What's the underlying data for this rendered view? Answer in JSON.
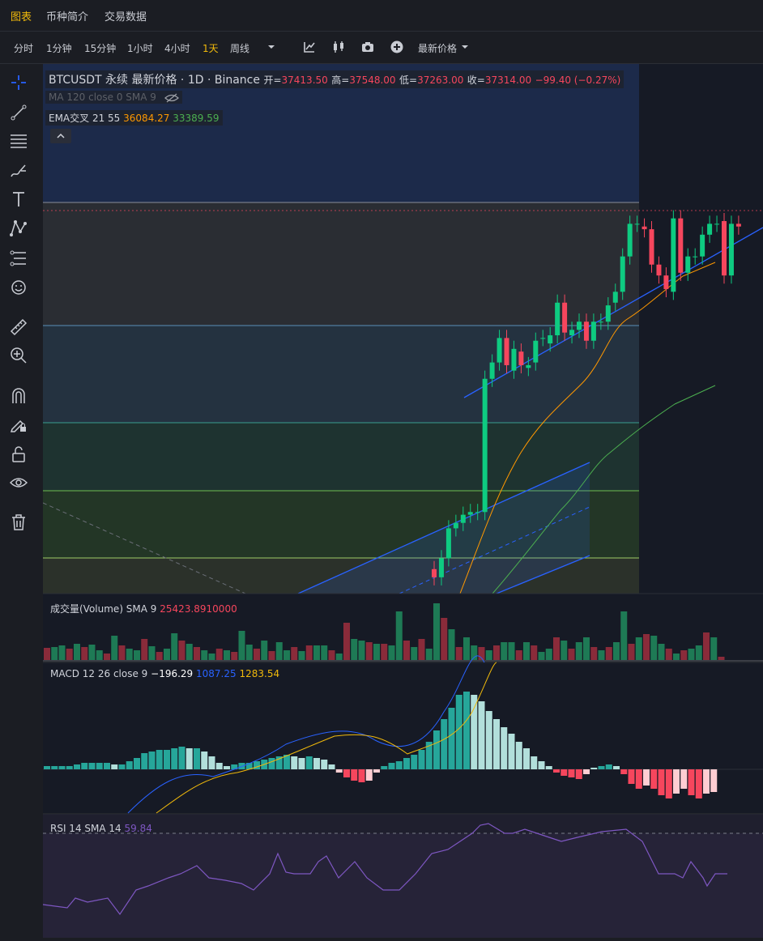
{
  "tabs": [
    "图表",
    "币种简介",
    "交易数据"
  ],
  "timeframes": [
    "分时",
    "1分钟",
    "15分钟",
    "1小时",
    "4小时",
    "1天",
    "周线"
  ],
  "active_timeframe": "1天",
  "price_type_label": "最新价格",
  "toolbar_icons": [
    "indicator-icon",
    "candle-type-icon",
    "camera-icon",
    "add-icon"
  ],
  "sidebar_icons": [
    "crosshair-icon",
    "trendline-icon",
    "horizontal-lines-icon",
    "brush-icon",
    "text-icon",
    "pattern-icon",
    "fib-icon",
    "emoji-icon",
    "ruler-icon",
    "zoom-in-icon",
    "magnet-icon",
    "lock-drawing-icon",
    "unlock-icon",
    "eye-icon",
    "trash-icon"
  ],
  "legend": {
    "symbol": "BTCUSDT 永续 最新价格 · 1D · Binance",
    "open_label": "开=",
    "open": "37413.50",
    "high_label": "高=",
    "high": "37548.00",
    "low_label": "低=",
    "low": "37263.00",
    "close_label": "收=",
    "close": "37314.00",
    "change": "−99.40 (−0.27%)",
    "ma_line": "MA 120 close 0 SMA 9",
    "ema_label": "EMA交叉 21 55",
    "ema21": "36084.27",
    "ema55": "33389.59"
  },
  "volume_legend": {
    "label": "成交量(Volume) SMA 9",
    "value": "25423.8910000"
  },
  "macd_legend": {
    "label": "MACD 12 26 close 9",
    "hist": "−196.29",
    "macd": "1087.25",
    "signal": "1283.54"
  },
  "rsi_legend": {
    "label": "RSI 14 SMA 14",
    "value": "59.84"
  },
  "colors": {
    "up": "#26a69a",
    "up_bright": "#0ecb81",
    "down": "#f6465d",
    "accent": "#f0b90b",
    "ema21": "#ff9800",
    "ema55": "#4caf50",
    "rsi": "#7e57c2",
    "macd": "#2962ff",
    "signal": "#f0b90b"
  },
  "chart_data": {
    "type": "candlestick",
    "symbol": "BTCUSDT",
    "interval": "1D",
    "last_close": 37314.0,
    "candles_recent": [
      {
        "o": 26900,
        "c": 26600
      },
      {
        "o": 26600,
        "c": 27300
      },
      {
        "o": 27300,
        "c": 28400
      },
      {
        "o": 28400,
        "c": 28600
      },
      {
        "o": 28600,
        "c": 28900
      },
      {
        "o": 28900,
        "c": 29000
      },
      {
        "o": 29000,
        "c": 29000
      },
      {
        "o": 29000,
        "c": 33900
      },
      {
        "o": 33900,
        "c": 34500
      },
      {
        "o": 34500,
        "c": 35400
      },
      {
        "o": 35400,
        "c": 34400
      },
      {
        "o": 34200,
        "c": 35000
      },
      {
        "o": 34900,
        "c": 34400
      },
      {
        "o": 34300,
        "c": 34400
      },
      {
        "o": 34500,
        "c": 35300
      },
      {
        "o": 35400,
        "c": 35400
      },
      {
        "o": 35200,
        "c": 35500
      },
      {
        "o": 35500,
        "c": 36700
      },
      {
        "o": 36700,
        "c": 35600
      },
      {
        "o": 35500,
        "c": 35700
      },
      {
        "o": 35700,
        "c": 36000
      },
      {
        "o": 36000,
        "c": 35300
      },
      {
        "o": 35300,
        "c": 36000
      },
      {
        "o": 36000,
        "c": 36000
      },
      {
        "o": 36000,
        "c": 36600
      },
      {
        "o": 36700,
        "c": 37100
      },
      {
        "o": 37100,
        "c": 38400
      },
      {
        "o": 38400,
        "c": 39600
      },
      {
        "o": 39600,
        "c": 39600
      },
      {
        "o": 39500,
        "c": 39400
      },
      {
        "o": 39400,
        "c": 38100
      },
      {
        "o": 38100,
        "c": 37700
      },
      {
        "o": 37700,
        "c": 37200
      },
      {
        "o": 37100,
        "c": 39800
      },
      {
        "o": 39800,
        "c": 37800
      },
      {
        "o": 37800,
        "c": 38400
      },
      {
        "o": 38400,
        "c": 38400
      },
      {
        "o": 38400,
        "c": 39200
      },
      {
        "o": 39200,
        "c": 39600
      },
      {
        "o": 39600,
        "c": 39600
      },
      {
        "o": 39700,
        "c": 37700
      },
      {
        "o": 37700,
        "c": 39600
      },
      {
        "o": 39600,
        "c": 39500
      }
    ]
  }
}
